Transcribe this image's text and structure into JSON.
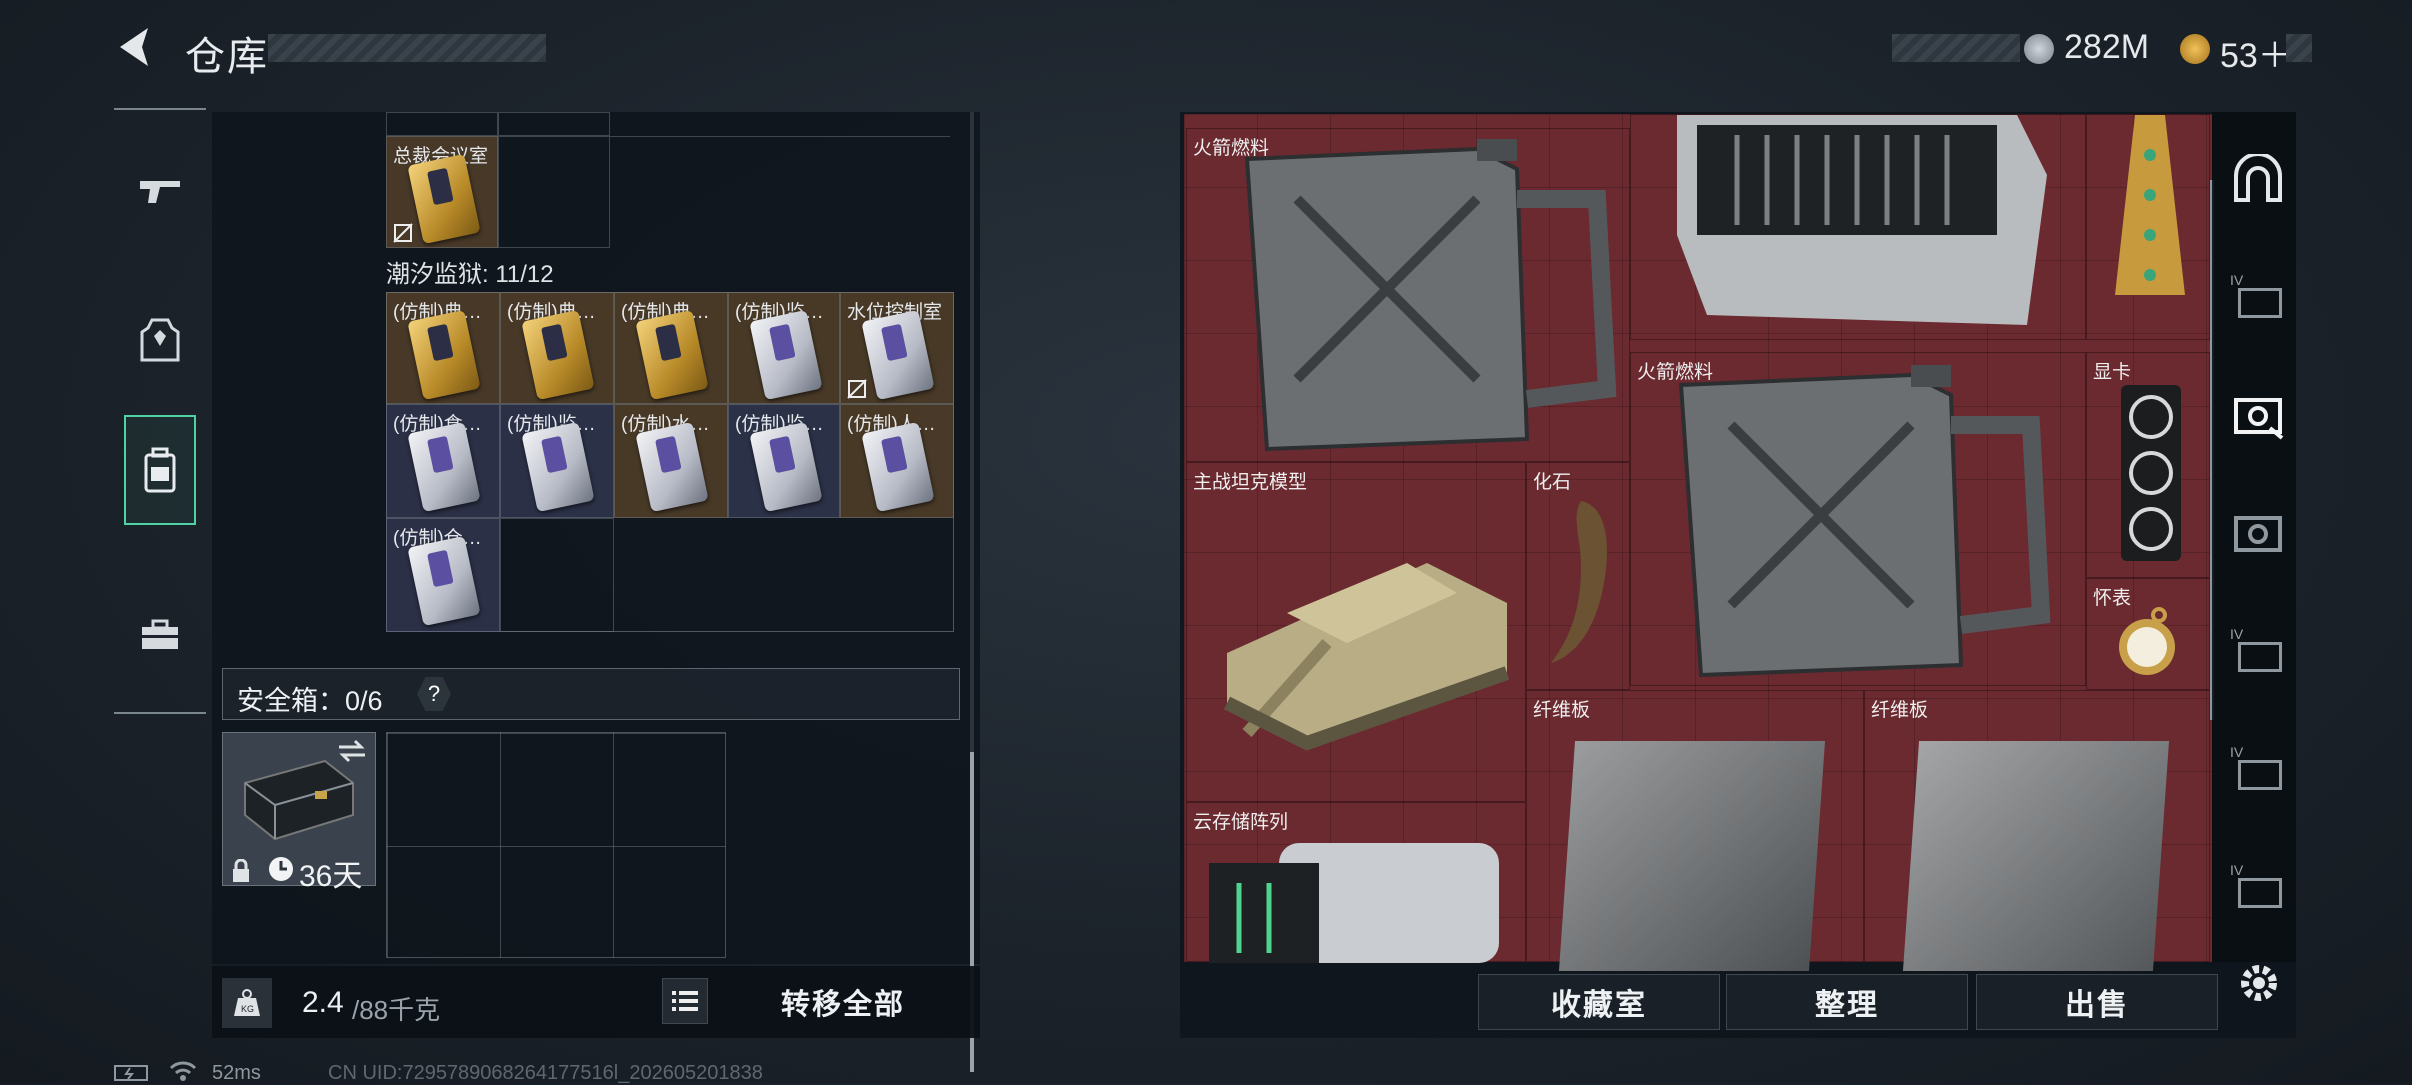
{
  "header": {
    "title": "仓库",
    "currency_1": "282M",
    "currency_2": "53＋"
  },
  "stash": {
    "row_top_label": "总裁会议室",
    "group_label": "潮汐监狱: 11/12",
    "items": [
      {
        "label": "(仿制)典…",
        "tone": "gold"
      },
      {
        "label": "(仿制)典…",
        "tone": "gold"
      },
      {
        "label": "(仿制)典…",
        "tone": "gold"
      },
      {
        "label": "(仿制)监…",
        "tone": "silver"
      },
      {
        "label": "水位控制室",
        "tone": "silver"
      },
      {
        "label": "(仿制)食…",
        "tone": "silver"
      },
      {
        "label": "(仿制)监…",
        "tone": "silver"
      },
      {
        "label": "(仿制)水…",
        "tone": "silver"
      },
      {
        "label": "(仿制)监…",
        "tone": "silver"
      },
      {
        "label": "(仿制)人…",
        "tone": "silver"
      },
      {
        "label": "(仿制)仓…",
        "tone": "silver"
      }
    ]
  },
  "safebox": {
    "label": "安全箱：0/6",
    "help": "?",
    "days": "36天"
  },
  "footer_left": {
    "weight": "2.4",
    "weight_max": "/88千克",
    "transfer_all": "转移全部"
  },
  "right": {
    "items": {
      "fuel1": "火箭燃料",
      "fuel2": "火箭燃料",
      "gpu": "显卡",
      "tank": "主战坦克模型",
      "fossil": "化石",
      "watch": "怀表",
      "fiber1": "纤维板",
      "fiber2": "纤维板",
      "storage": "云存储阵列"
    },
    "buttons": {
      "collection": "收藏室",
      "organize": "整理",
      "sell": "出售"
    },
    "tab_marks": [
      "IV",
      "IV",
      "IV",
      "IV"
    ]
  },
  "status": {
    "ping": "52ms",
    "uid": "CN UID:7295789068264177516l_202605201838"
  }
}
